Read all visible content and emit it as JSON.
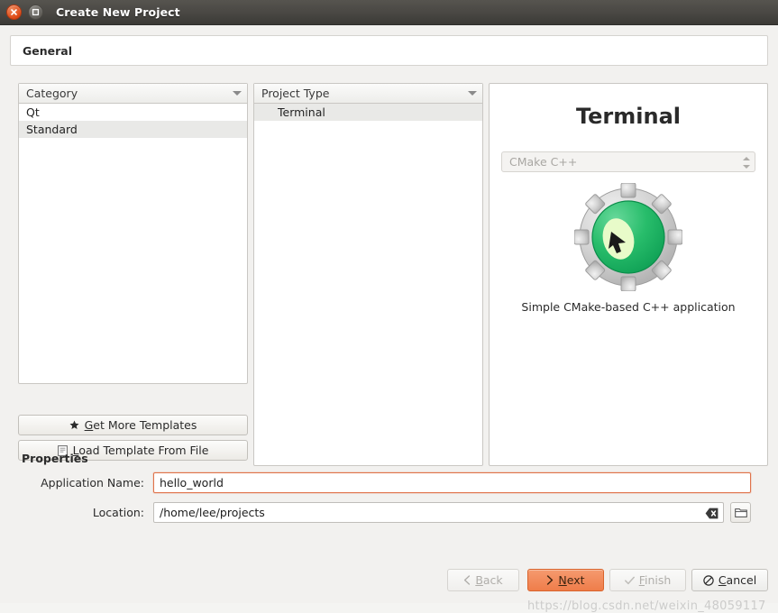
{
  "window": {
    "title": "Create New Project",
    "close_icon": "close-icon",
    "maximize_icon": "maximize-icon"
  },
  "header": {
    "title": "General"
  },
  "category_panel": {
    "header_label": "Category",
    "sort_icon": "chevron-down-icon",
    "items": [
      {
        "label": "Qt",
        "selected": false,
        "indent": false
      },
      {
        "label": "Standard",
        "selected": true,
        "indent": false
      }
    ]
  },
  "project_type_panel": {
    "header_label": "Project Type",
    "sort_icon": "chevron-down-icon",
    "items": [
      {
        "label": "Terminal",
        "selected": true,
        "indent": true
      }
    ]
  },
  "template_buttons": {
    "get_more": {
      "label": "Get More Templates",
      "accel": "G",
      "icon": "star-icon"
    },
    "load_file": {
      "label": "Load Template From File",
      "accel": "L",
      "icon": "document-icon"
    }
  },
  "preview": {
    "title": "Terminal",
    "language_value": "CMake C++",
    "description": "Simple CMake-based C++ application",
    "app_icon": "kdevelop-gear-icon",
    "gear_color": "#c8c8c8",
    "inner_color": "#2bbf6e"
  },
  "properties": {
    "section_title": "Properties",
    "app_name": {
      "label": "Application Name:",
      "value": "hello_world",
      "placeholder": ""
    },
    "location": {
      "label": "Location:",
      "value": "/home/lee/projects",
      "placeholder": "",
      "clear_icon": "clear-icon",
      "browse_icon": "folder-icon"
    }
  },
  "footer": {
    "back": {
      "label": "Back",
      "accel": "B",
      "icon": "chevron-left-icon",
      "enabled": false
    },
    "next": {
      "label": "Next",
      "accel": "N",
      "icon": "chevron-right-icon",
      "enabled": true,
      "primary": true
    },
    "finish": {
      "label": "Finish",
      "accel": "F",
      "icon": "check-icon",
      "enabled": false
    },
    "cancel": {
      "label": "Cancel",
      "accel": "C",
      "icon": "cancel-icon",
      "enabled": true
    }
  },
  "watermark": {
    "text": "https://blog.csdn.net/weixin_48059117"
  },
  "colors": {
    "accent": "#ef7d4a",
    "titlebar": "#4a4844",
    "selection": "#e9e9e7",
    "focus_border": "#e0734a"
  }
}
